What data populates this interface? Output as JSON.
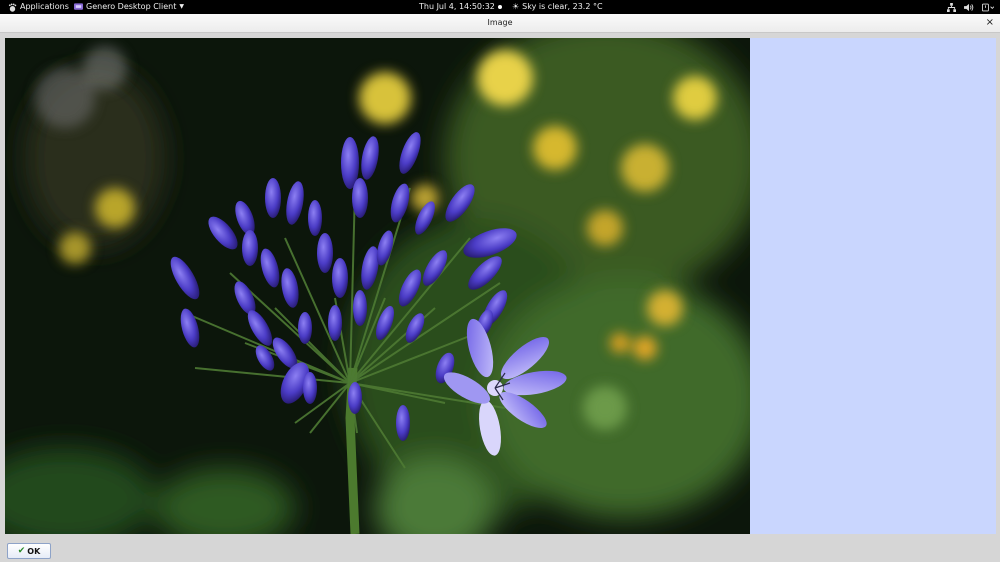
{
  "topbar": {
    "apps_label": "Applications",
    "app_name": "Genero Desktop Client",
    "clock": "Thu Jul  4, 14:50:32",
    "weather": "Sky is clear, 23.2 °C"
  },
  "window": {
    "title": "Image",
    "close_glyph": "×"
  },
  "image": {
    "subject": "purple agapanthus flower",
    "colors": {
      "background": "#0e1a0c",
      "flower": "#5a4ad8",
      "petal_light": "#a9a3f5",
      "stem": "#4c7a2e",
      "bokeh_yellow": "#d8c23a"
    }
  },
  "side_panel": {
    "color": "#c9d6fe"
  },
  "footer": {
    "ok_label": "OK"
  },
  "icons": [
    "gnome-foot-icon",
    "app-icon",
    "weather-icon",
    "network-icon",
    "volume-icon",
    "power-icon"
  ]
}
